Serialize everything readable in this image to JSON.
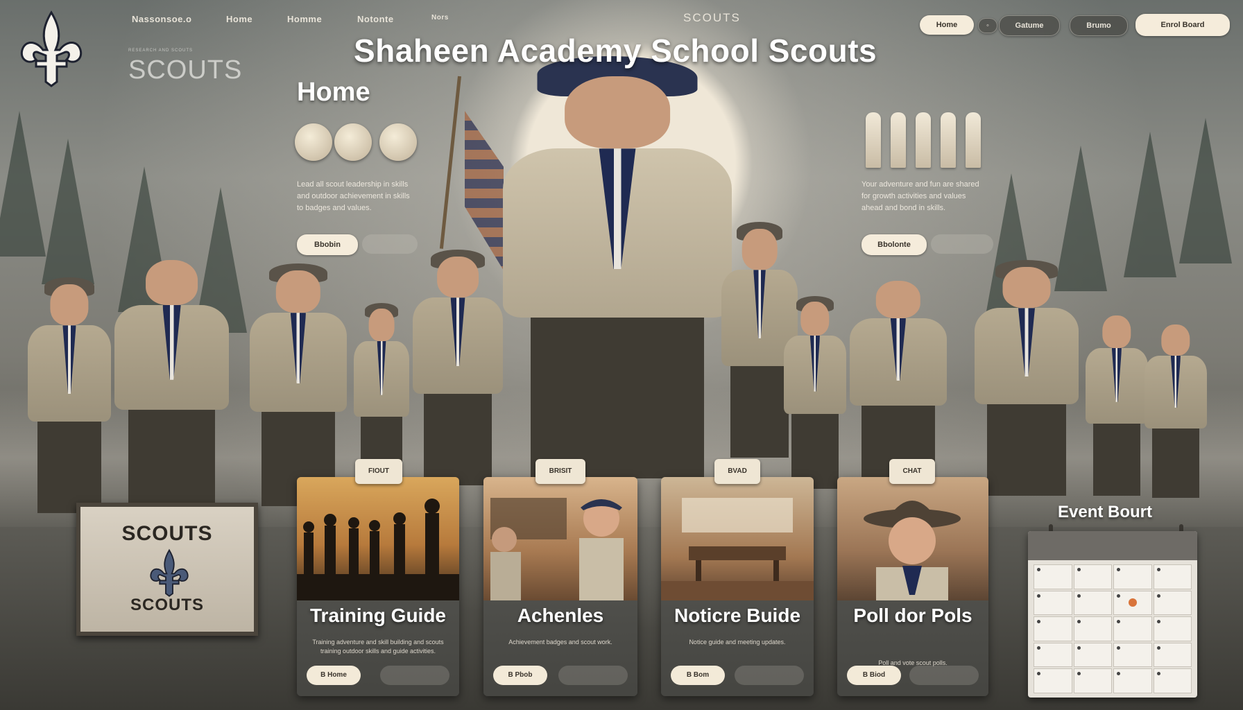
{
  "header": {
    "nav_links": [
      "Nassonsoe.o",
      "Home",
      "Homme",
      "Notonte",
      "Nors"
    ],
    "brand_small": "SCOUTS",
    "site_subtitle": "SCOUTS",
    "site_subtitle_tag": "RESEARCH AND SCOUTS",
    "actions": [
      "Home",
      "Gatume",
      "Brumo",
      "Enrol Board"
    ],
    "main_title": "Shaheen Academy School Scouts"
  },
  "hero": {
    "heading": "Home",
    "left_text": "Lead all scout leadership in skills and outdoor achievement in skills to badges and values.",
    "left_button": "Bbobin",
    "right_text": "Your adventure and fun are shared for growth activities and values ahead and bond in skills.",
    "right_button": "Bbolonte"
  },
  "sign": {
    "top": "SCOUTS",
    "bottom": "SCOUTS"
  },
  "cards": [
    {
      "tab": "FIOUT",
      "title": "Training Guide",
      "desc": "Training adventure and skill building and scouts training outdoor skills and guide activities.",
      "button": "B Home"
    },
    {
      "tab": "BRISIT",
      "title": "Achenles",
      "desc": "Achievement badges and scout work.",
      "button": "B Pbob"
    },
    {
      "tab": "BVAD",
      "title": "Noticre Buide",
      "desc": "Notice guide and meeting updates.",
      "button": "B Bom"
    },
    {
      "tab": "CHAT",
      "title": "Poll dor Pols",
      "desc": "Poll and vote scout polls.",
      "button": "B Biod"
    }
  ],
  "events": {
    "title": "Event Bourt"
  },
  "colors": {
    "accent_cream": "#efe6d4",
    "scarf_navy": "#1f2a52",
    "calendar_mark": "#d9743a"
  }
}
